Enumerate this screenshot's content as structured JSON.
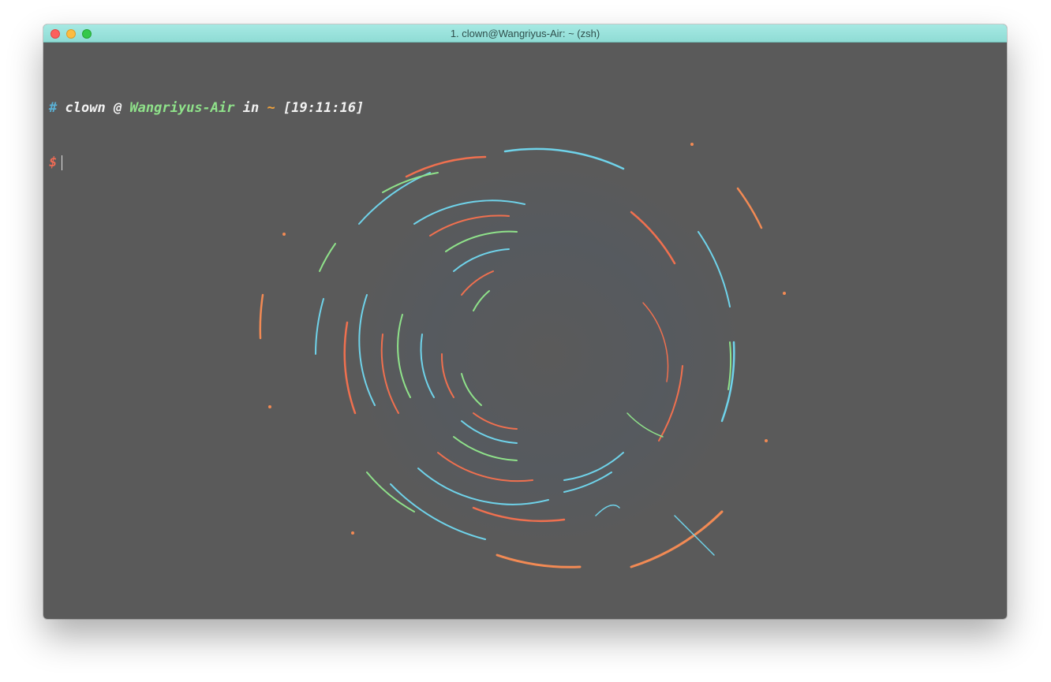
{
  "window": {
    "title": "1. clown@Wangriyus-Air: ~ (zsh)"
  },
  "prompt": {
    "hash": "#",
    "user": "clown",
    "at": "@",
    "host": "Wangriyus-Air",
    "in": "in",
    "dir": "~",
    "time": "[19:11:16]",
    "dollar": "$"
  },
  "colors": {
    "terminal_bg": "#5a5a5a",
    "hash": "#5ab1d6",
    "user": "#f2f2f2",
    "host": "#8fe28a",
    "dir": "#f0a23c",
    "dollar": "#ef6b55",
    "titlebar": "#9ce3dc"
  }
}
